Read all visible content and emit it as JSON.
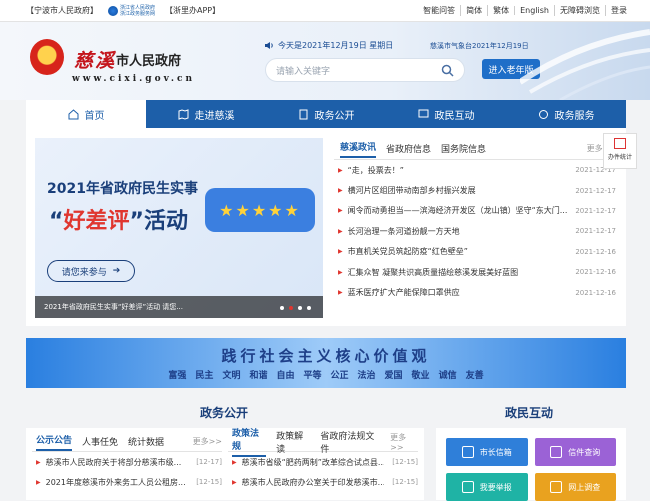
{
  "topbar": {
    "left": [
      "【宁波市人民政府】",
      "【浙里办APP】"
    ],
    "zj_logo": [
      "浙江省人民政府",
      "浙江政务服务网"
    ],
    "right": [
      "智能问答",
      "简体",
      "繁体",
      "English",
      "无障碍浏览",
      "登录"
    ]
  },
  "header": {
    "city": "慈溪",
    "gov": "市人民政府",
    "domain": "www.cixi.gov.cn",
    "today": "今天是2021年12月19日 星期日",
    "weather": "慈溪市气象台2021年12月19日",
    "search_placeholder": "请输入关键字",
    "elder_button": "进入老年版"
  },
  "nav": [
    "首页",
    "走进慈溪",
    "政务公开",
    "政民互动",
    "政务服务"
  ],
  "banner": {
    "title1": "2021年省政府民生实事",
    "title2_pre": "“",
    "title2_hl": "好差评",
    "title2_post": "”活动",
    "stars": "★★★★★",
    "join": "请您来参与",
    "caption": "2021年省政府民生实事“好差评”活动 请您..."
  },
  "news": {
    "tabs": [
      "慈溪政讯",
      "省政府信息",
      "国务院信息"
    ],
    "more": "更多>>",
    "items": [
      {
        "title": "“走，投票去！”",
        "date": "2021-12-17"
      },
      {
        "title": "横河片区组团带动南部乡村振兴发展",
        "date": "2021-12-17"
      },
      {
        "title": "闻令而动勇担当——滨海经济开发区（龙山镇）坚守“东大门...",
        "date": "2021-12-17"
      },
      {
        "title": "长河治理一条河道扮靓一方天地",
        "date": "2021-12-17"
      },
      {
        "title": "市直机关党员筑起防疫“红色壁垒”",
        "date": "2021-12-16"
      },
      {
        "title": "汇集众智 凝聚共识高质量描绘慈溪发展美好蓝图",
        "date": "2021-12-16"
      },
      {
        "title": "蓝禾医疗扩大产能保障口罩供应",
        "date": "2021-12-16"
      }
    ]
  },
  "float_btn": "办件统计",
  "values": {
    "title": "践行社会主义核心价值观",
    "words": [
      "富强",
      "民主",
      "文明",
      "和谐",
      "自由",
      "平等",
      "公正",
      "法治",
      "爱国",
      "敬业",
      "诚信",
      "友善"
    ]
  },
  "sections": {
    "gov_open": "政务公开",
    "interaction": "政民互动"
  },
  "gov_left": {
    "tabs": [
      "公示公告",
      "人事任免",
      "统计数据"
    ],
    "more": "更多>>",
    "items": [
      {
        "title": "慈溪市人民政府关于将部分慈溪市级...",
        "date": "[12-17]"
      },
      {
        "title": "2021年度慈溪市外来务工人员公租房...",
        "date": "[12-15]"
      }
    ]
  },
  "gov_right": {
    "tabs": [
      "政策法规",
      "政策解读",
      "省政府法规文件"
    ],
    "more": "更多>>",
    "items": [
      {
        "title": "慈溪市省级“肥药两制”改革综合试点县...",
        "date": "[12-15]"
      },
      {
        "title": "慈溪市人民政府办公室关于印发慈溪市...",
        "date": "[12-15]"
      }
    ]
  },
  "interaction": [
    {
      "label": "市长信箱",
      "color": "#2f7fd9"
    },
    {
      "label": "信件查询",
      "color": "#9b62d6"
    },
    {
      "label": "我要举报",
      "color": "#1fb3a5"
    },
    {
      "label": "网上调查",
      "color": "#e9a21f"
    }
  ]
}
